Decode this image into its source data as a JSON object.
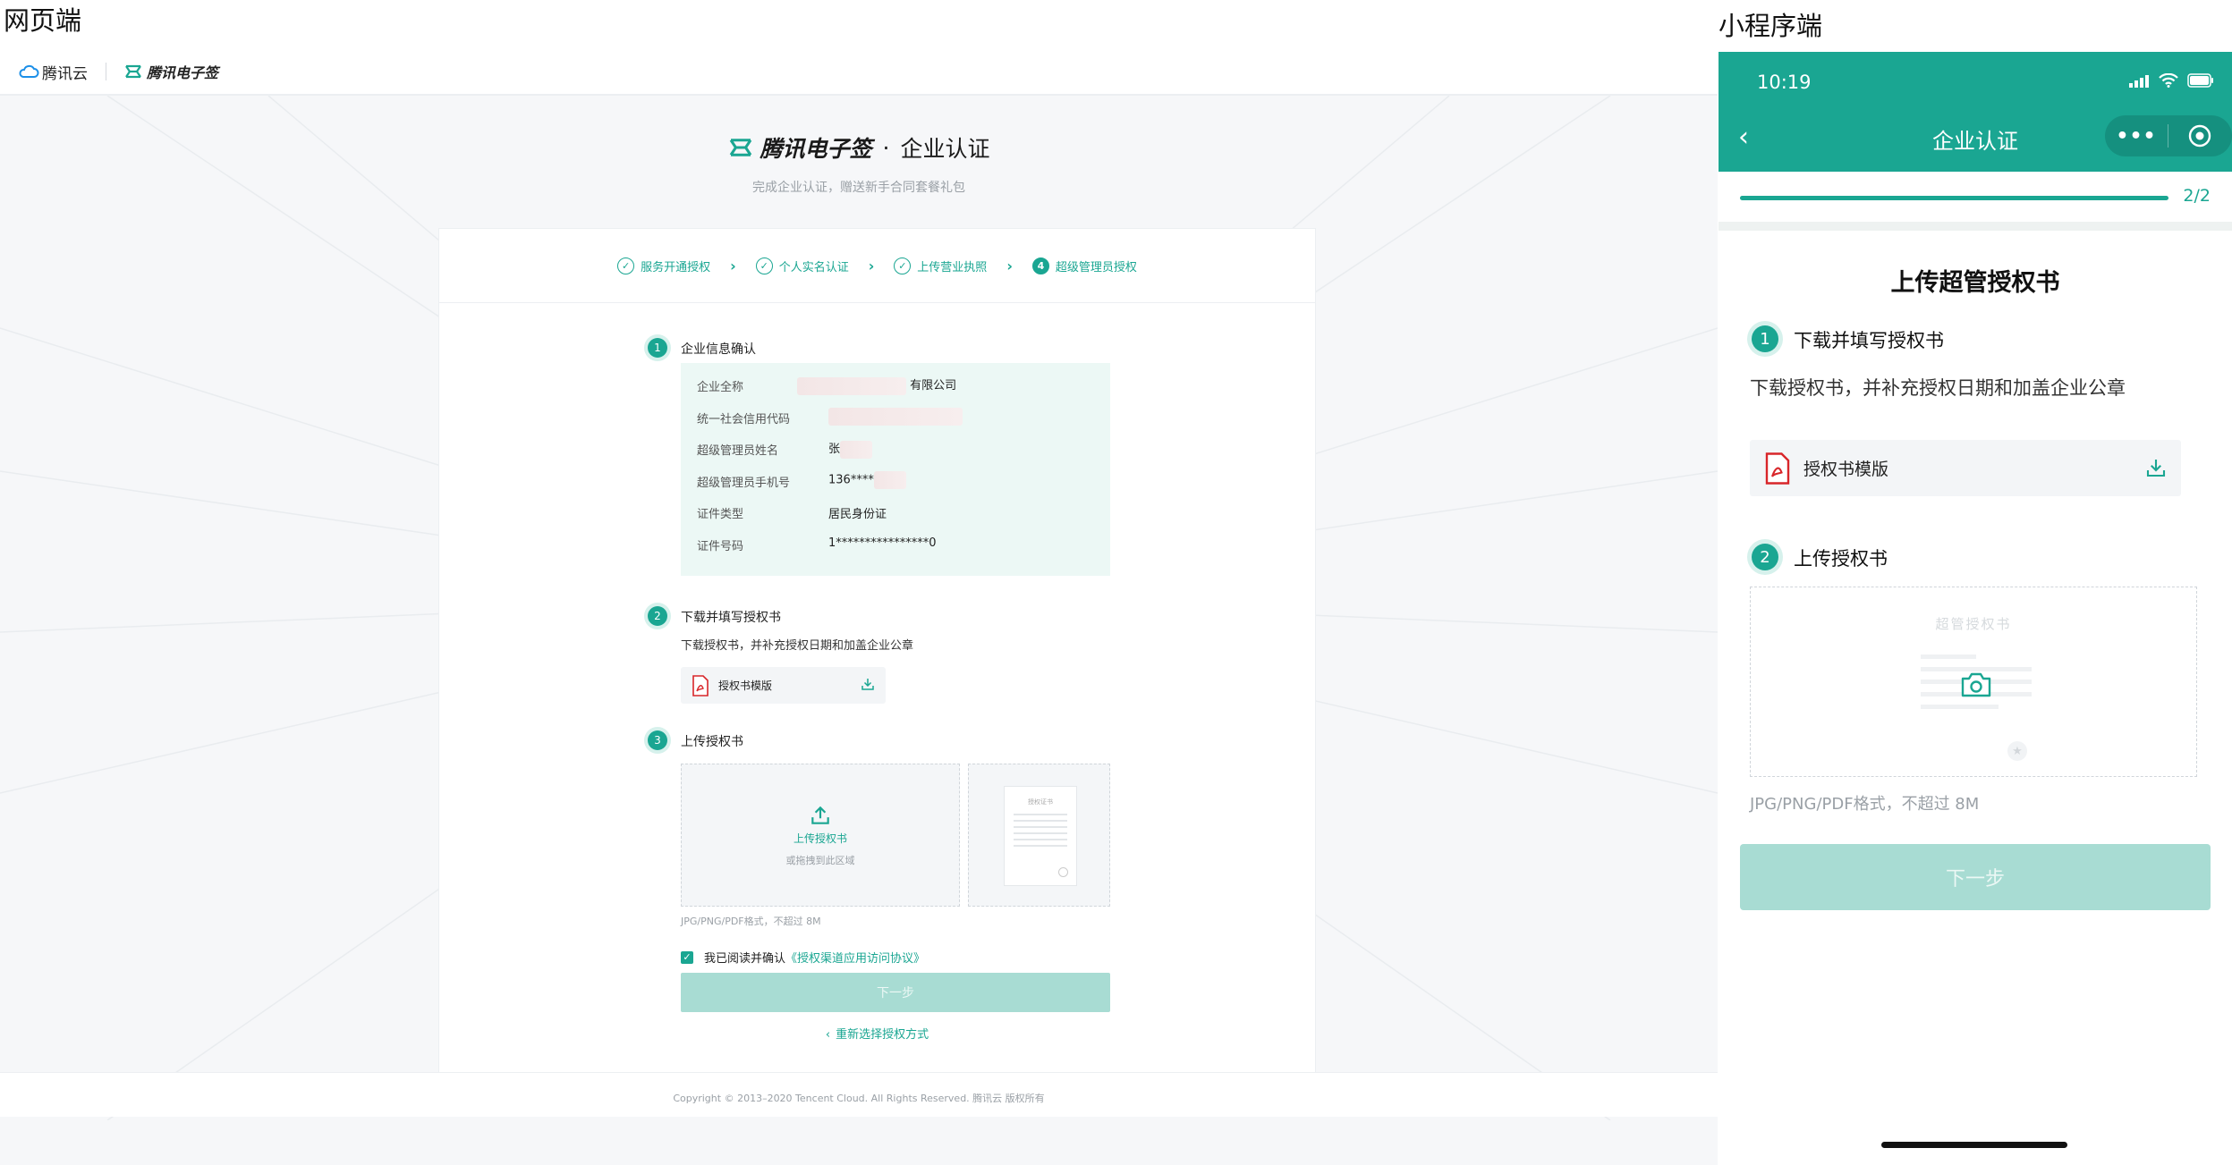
{
  "labels": {
    "web": "网页端",
    "mini": "小程序端"
  },
  "web": {
    "topbar": {
      "cloud_logo": "腾讯云",
      "esign_logo": "腾讯电子签"
    },
    "brand": {
      "name": "腾讯电子签",
      "dot": "·",
      "title": "企业认证",
      "subtitle": "完成企业认证，赠送新手合同套餐礼包"
    },
    "steps": [
      {
        "label": "服务开通授权",
        "state": "done"
      },
      {
        "label": "个人实名认证",
        "state": "done"
      },
      {
        "label": "上传营业执照",
        "state": "done"
      },
      {
        "label": "超级管理员授权",
        "state": "current",
        "num": "4"
      }
    ],
    "section1": {
      "num": "1",
      "title": "企业信息确认",
      "rows": [
        {
          "label": "企业全称",
          "value": "有限公司"
        },
        {
          "label": "统一社会信用代码",
          "value": ""
        },
        {
          "label": "超级管理员姓名",
          "value": "张"
        },
        {
          "label": "超级管理员手机号",
          "value": "136****"
        },
        {
          "label": "证件类型",
          "value": "居民身份证"
        },
        {
          "label": "证件号码",
          "value": "1****************0"
        }
      ]
    },
    "section2": {
      "num": "2",
      "title": "下载并填写授权书",
      "desc": "下载授权书，并补充授权日期和加盖企业公章",
      "template": "授权书模版"
    },
    "section3": {
      "num": "3",
      "title": "上传授权书",
      "upload_title": "上传授权书",
      "upload_hint": "或拖拽到此区域",
      "sample_title": "授权证书",
      "format": "JPG/PNG/PDF格式，不超过 8M"
    },
    "agree": {
      "prefix": "我已阅读并确认",
      "link": "《授权渠道应用访问协议》"
    },
    "next": "下一步",
    "reselect": "重新选择授权方式",
    "footer": "Copyright © 2013–2020 Tencent Cloud. All Rights Reserved. 腾讯云 版权所有"
  },
  "mini": {
    "status_time": "10:19",
    "nav_title": "企业认证",
    "progress_text": "2/2",
    "progress_fraction": 1.0,
    "page_title": "上传超管授权书",
    "section1": {
      "num": "1",
      "title": "下载并填写授权书",
      "desc": "下载授权书，并补充授权日期和加盖企业公章",
      "template": "授权书模版"
    },
    "section2": {
      "num": "2",
      "title": "上传授权书",
      "placeholder_title": "超管授权书",
      "format": "JPG/PNG/PDF格式，不超过 8M"
    },
    "next": "下一步"
  },
  "colors": {
    "brand": "#1aa692",
    "brand_light": "#ecf8f5",
    "button_disabled": "#a8dcd3"
  },
  "icons": [
    "cloud-icon",
    "esign-icon",
    "check-circle-icon",
    "chevron-right-icon",
    "pdf-icon",
    "download-icon",
    "upload-icon",
    "camera-icon",
    "back-icon",
    "more-icon",
    "target-icon",
    "signal-icon",
    "wifi-icon",
    "battery-icon"
  ]
}
